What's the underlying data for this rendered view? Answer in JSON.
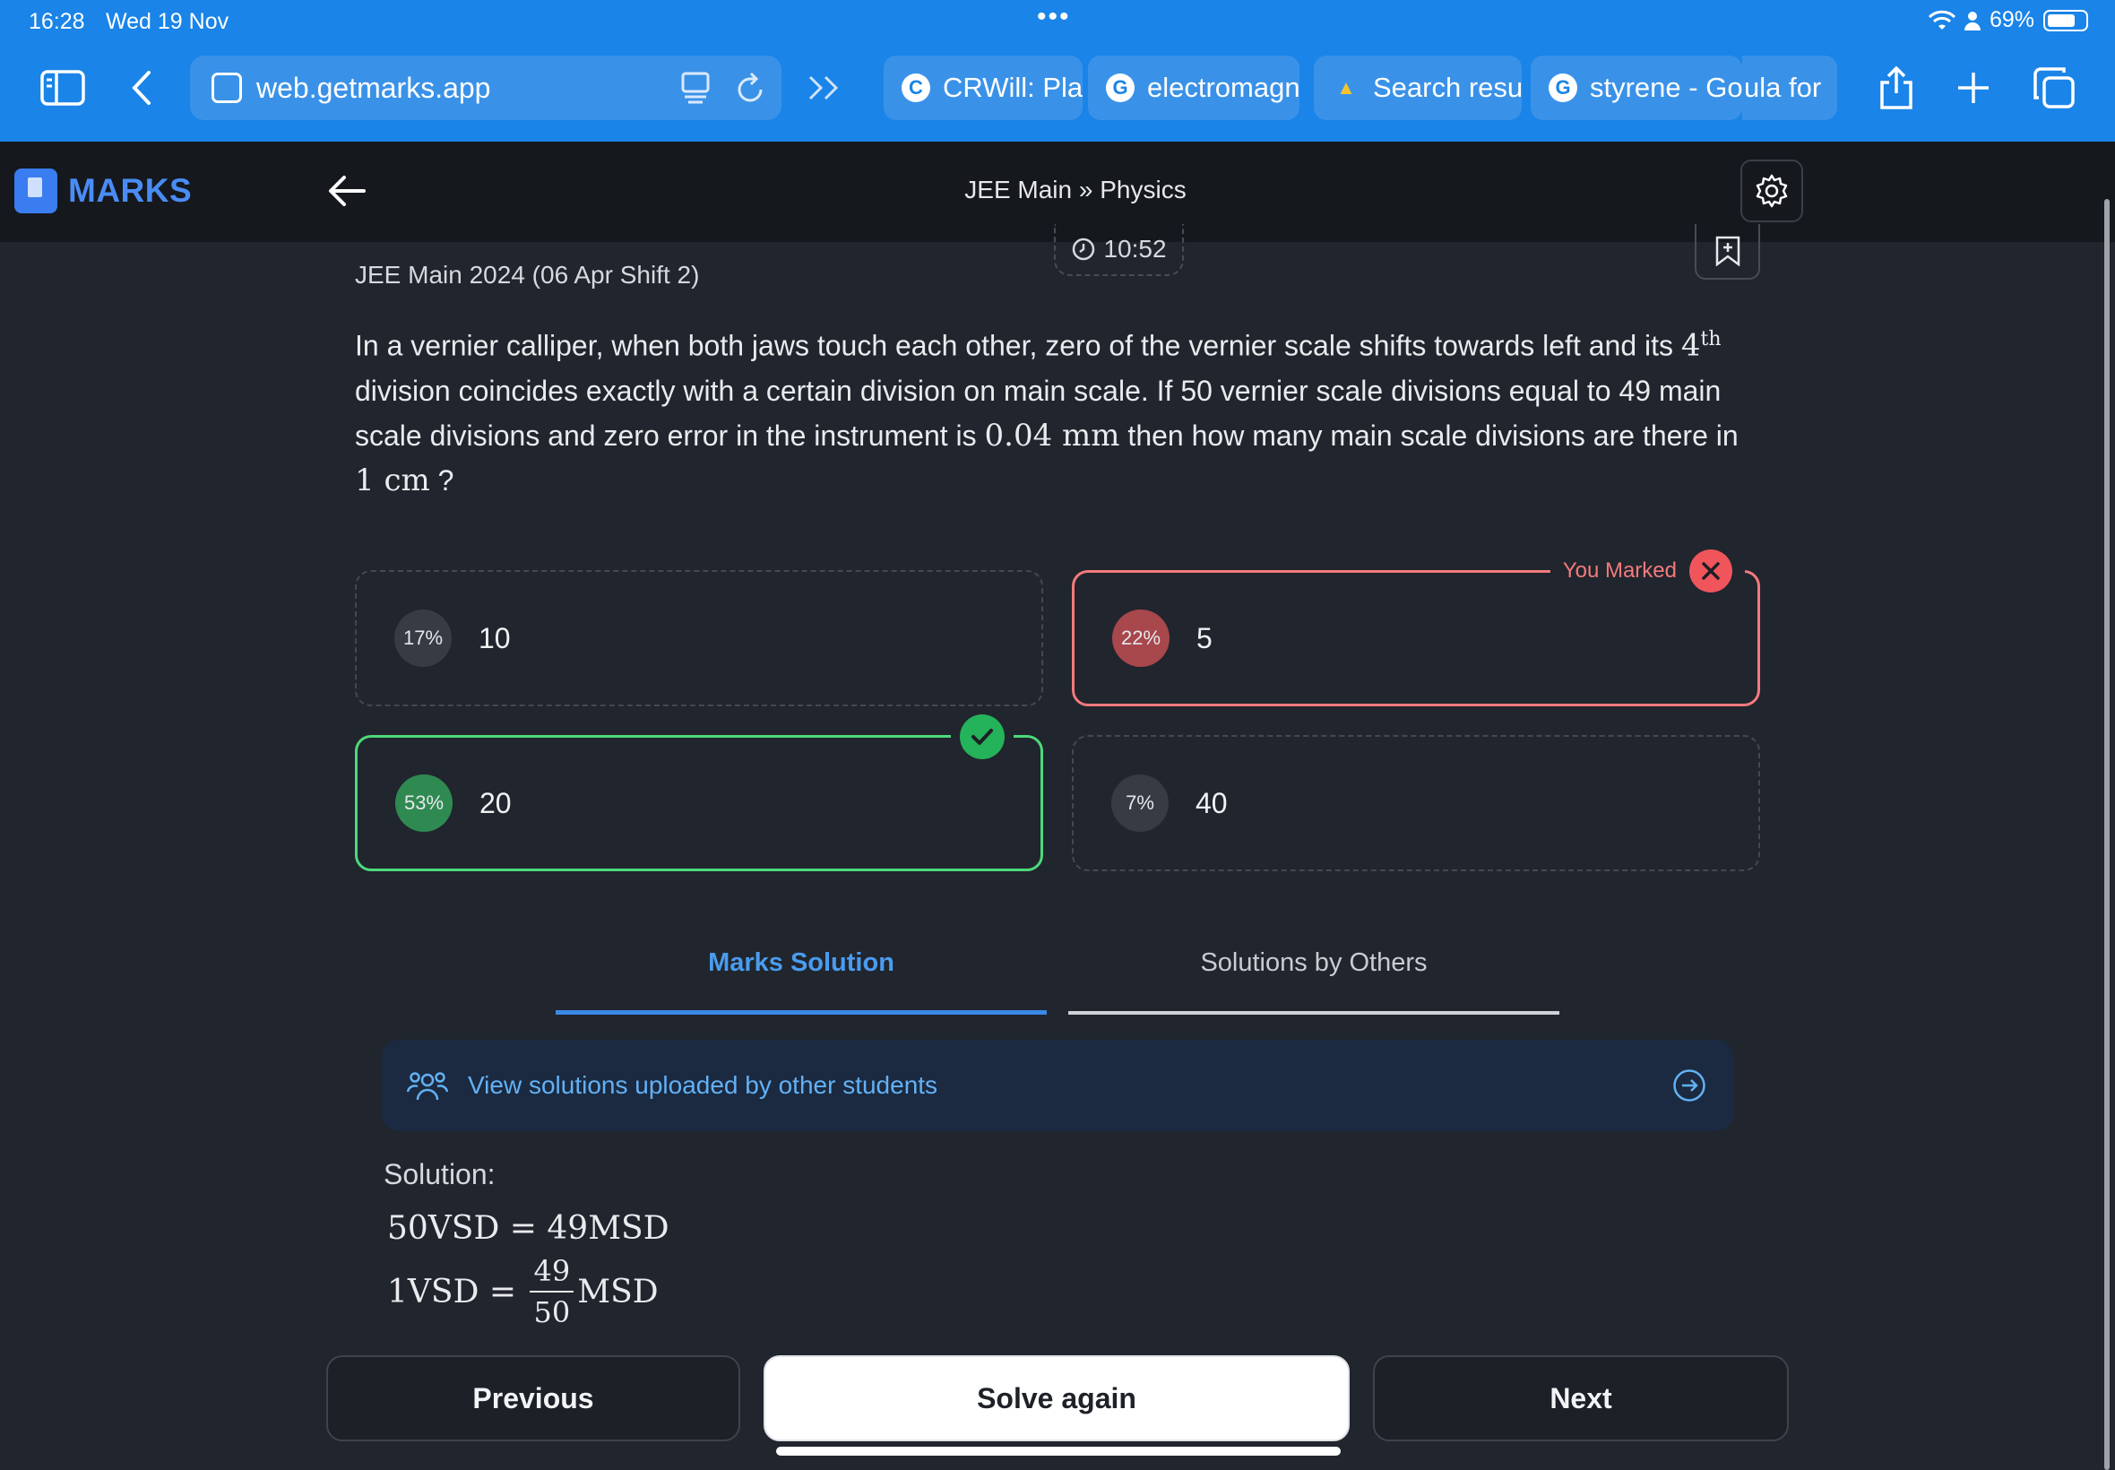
{
  "status": {
    "time": "16:28",
    "date": "Wed 19 Nov",
    "battery": "69%"
  },
  "browser": {
    "url": "web.getmarks.app",
    "tabs": [
      {
        "label": "CRWill: Play",
        "favicon": "C"
      },
      {
        "label": "electromagn",
        "favicon": "G"
      },
      {
        "label": "Search resu",
        "favicon": "▲"
      },
      {
        "label": "styrene - Go",
        "favicon": "G"
      },
      {
        "label": "ula for",
        "favicon": ""
      }
    ]
  },
  "app": {
    "logo_text": "MARKS",
    "breadcrumb": "JEE Main » Physics"
  },
  "question": {
    "timer": "10:52",
    "exam": "JEE Main 2024 (06 Apr Shift 2)",
    "text_part1": "In a vernier calliper, when both jaws touch each other, zero of the vernier scale shifts towards left and its ",
    "ordinal_num": "4",
    "ordinal_sup": "th",
    "text_part2": " division coincides exactly with a certain division on main scale. If 50 vernier scale divisions equal to 49 main scale divisions and zero error in the instrument is ",
    "math1": "0.04 mm",
    "text_part3": " then how many main scale divisions are there in ",
    "math2": "1 cm",
    "text_part4": " ?"
  },
  "options": [
    {
      "pct": "17%",
      "value": "10"
    },
    {
      "pct": "22%",
      "value": "5",
      "tag": "You Marked"
    },
    {
      "pct": "53%",
      "value": "20"
    },
    {
      "pct": "7%",
      "value": "40"
    }
  ],
  "solution_tabs": {
    "active": "Marks Solution",
    "other": "Solutions by Others"
  },
  "others_banner": "View solutions uploaded by other students",
  "solution": {
    "label": "Solution:",
    "eq1": "50VSD = 49MSD",
    "eq2_lhs": "1VSD = ",
    "eq2_num": "49",
    "eq2_den": "50",
    "eq2_rhs": "MSD"
  },
  "nav": {
    "previous": "Previous",
    "solve_again": "Solve again",
    "next": "Next"
  },
  "colors": {
    "browser_blue": "#1a84e8",
    "wrong": "#f37a7d",
    "correct": "#4cd97b",
    "accent": "#4a9cf0"
  }
}
